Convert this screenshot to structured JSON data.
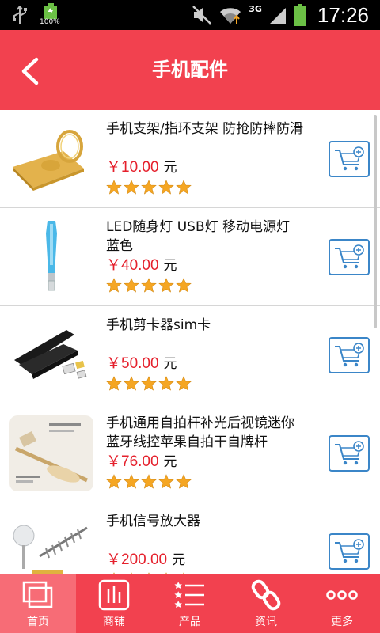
{
  "status_bar": {
    "battery_left_pct": "100%",
    "network": "3G",
    "time": "17:26"
  },
  "header": {
    "title": "手机配件"
  },
  "products": [
    {
      "name": " 手机支架/指环支架 防抢防摔防滑",
      "price": "￥10.00",
      "unit": "元",
      "rating": 5
    },
    {
      "name": " LED随身灯 USB灯 移动电源灯 蓝色",
      "price": "￥40.00",
      "unit": "元",
      "rating": 5
    },
    {
      "name": "手机剪卡器sim卡",
      "price": "￥50.00",
      "unit": "元",
      "rating": 5
    },
    {
      "name": "手机通用自拍杆补光后视镜迷你蓝牙线控苹果自拍干自牌杆",
      "price": "￥76.00",
      "unit": "元",
      "rating": 5
    },
    {
      "name": "手机信号放大器",
      "price": "￥200.00",
      "unit": "元",
      "rating": 5
    }
  ],
  "tabs": [
    {
      "label": "首页",
      "icon": "home-icon",
      "active": true
    },
    {
      "label": "商铺",
      "icon": "shop-icon",
      "active": false
    },
    {
      "label": "产品",
      "icon": "product-list-icon",
      "active": false
    },
    {
      "label": "资讯",
      "icon": "link-icon",
      "active": false
    },
    {
      "label": "更多",
      "icon": "more-icon",
      "active": false
    }
  ],
  "colors": {
    "brand_red": "#f2414f",
    "price_red": "#e5202c",
    "cart_blue": "#3b86c8",
    "star_orange": "#f5a623"
  }
}
